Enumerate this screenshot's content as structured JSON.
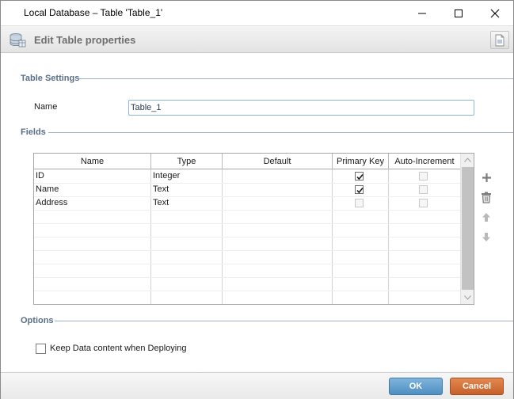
{
  "window": {
    "title": "Local Database – Table 'Table_1'",
    "controls": {
      "minimize": "minimize-icon",
      "maximize": "maximize-icon",
      "close": "close-icon"
    }
  },
  "header": {
    "title": "Edit Table properties",
    "icon": "database-icon",
    "help_icon": "document-icon"
  },
  "table_settings": {
    "section_label": "Table Settings",
    "name_label": "Name",
    "name_value": "Table_1"
  },
  "fields": {
    "section_label": "Fields",
    "columns": [
      "Name",
      "Type",
      "Default",
      "Primary Key",
      "Auto-Increment"
    ],
    "rows": [
      {
        "name": "ID",
        "type": "Integer",
        "default": "",
        "primary_key": true,
        "auto_increment": false
      },
      {
        "name": "Name",
        "type": "Text",
        "default": "",
        "primary_key": true,
        "auto_increment": false
      },
      {
        "name": "Address",
        "type": "Text",
        "default": "",
        "primary_key": false,
        "auto_increment": false
      }
    ],
    "tools": [
      "add-icon",
      "delete-icon",
      "move-up-icon",
      "move-down-icon"
    ]
  },
  "options": {
    "section_label": "Options",
    "keep_data_label": "Keep Data content when Deploying",
    "keep_data_checked": false
  },
  "footer": {
    "ok_label": "OK",
    "cancel_label": "Cancel"
  },
  "colors": {
    "section_text": "#5a6f86",
    "ok_button": "#5f9dcc",
    "cancel_button": "#d36f38"
  }
}
